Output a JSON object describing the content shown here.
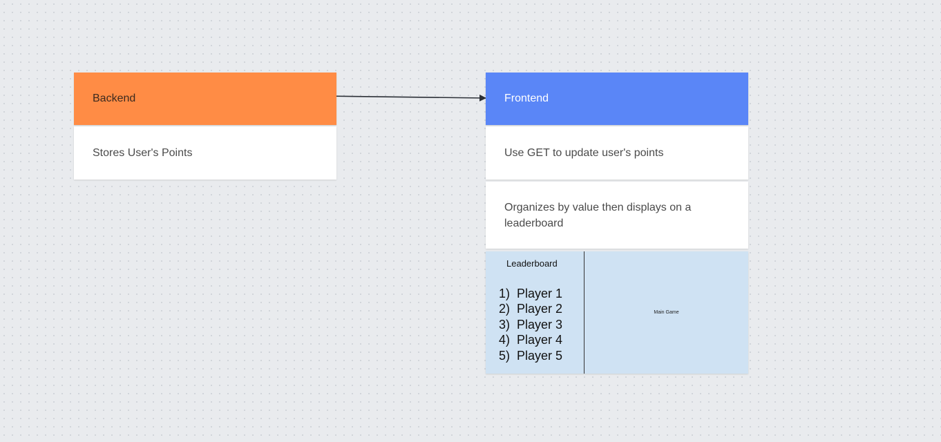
{
  "backend": {
    "title": "Backend",
    "rows": [
      "Stores User's Points"
    ],
    "color": "#ff8c45"
  },
  "frontend": {
    "title": "Frontend",
    "rows": [
      "Use GET to update user's points",
      "Organizes by value then displays on a leaderboard"
    ],
    "color": "#5a86f7"
  },
  "mockup": {
    "leaderboard_title": "Leaderboard",
    "players": [
      {
        "rank": "1)",
        "name": "Player 1"
      },
      {
        "rank": "2)",
        "name": "Player 2"
      },
      {
        "rank": "3)",
        "name": "Player 3"
      },
      {
        "rank": "4)",
        "name": "Player 4"
      },
      {
        "rank": "5)",
        "name": "Player 5"
      }
    ],
    "main_game_label": "Main Game",
    "color": "#cfe2f3"
  },
  "connector": {
    "from": "Backend",
    "to": "Frontend",
    "icon": "arrow-right-icon"
  }
}
